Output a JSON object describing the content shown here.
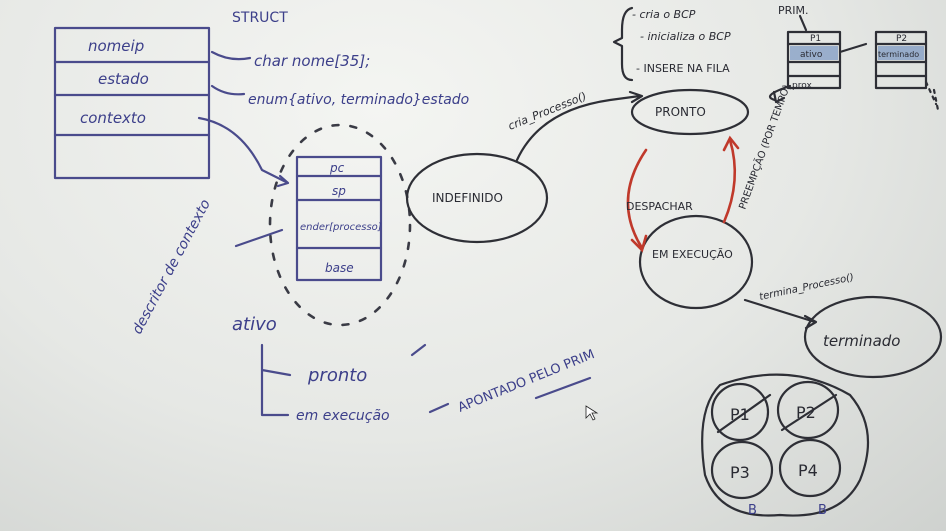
{
  "struct": {
    "fields": [
      "nomeip",
      "estado",
      "contexto"
    ],
    "title": "STRUCT",
    "name_decl": "char nome[35];",
    "enum_decl": "enum{ativo, terminado}estado"
  },
  "bcp_stack": {
    "cells": [
      "pc",
      "sp",
      "ender[processo]",
      "base"
    ],
    "label": "descritor de contexto",
    "ativo_label": "ativo",
    "pronto_label": "pronto",
    "execucao_label": "em execução",
    "apontado": "APONTADO PELO PRIM"
  },
  "states": {
    "indefinido": "INDEFINIDO",
    "pronto": "PRONTO",
    "em_execucao": "EM EXECUÇÃO",
    "terminado": "terminado"
  },
  "transitions": {
    "cria_processo": "cria_Processo()",
    "despachar": "DESPACHAR",
    "preempcao": "PREEMPÇÃO (POR TEMPO)",
    "termina_processo": "termina_Processo()"
  },
  "steps": [
    "- cria o BCP",
    "- inicializa o BCP",
    "- INSERE NA FILA"
  ],
  "queue": {
    "prim_label": "PRIM.",
    "node_labels": [
      "P1",
      "P2"
    ],
    "fields": [
      "ativo",
      "terminado"
    ],
    "prox_label": "prox"
  },
  "pool": {
    "processes": [
      "P1",
      "P2",
      "P3",
      "P4"
    ],
    "b_labels": [
      "B",
      "B"
    ]
  },
  "colors": {
    "marker_blue": "#4a4b8c",
    "marker_black": "#2e2f36",
    "marker_red": "#c0392b"
  }
}
